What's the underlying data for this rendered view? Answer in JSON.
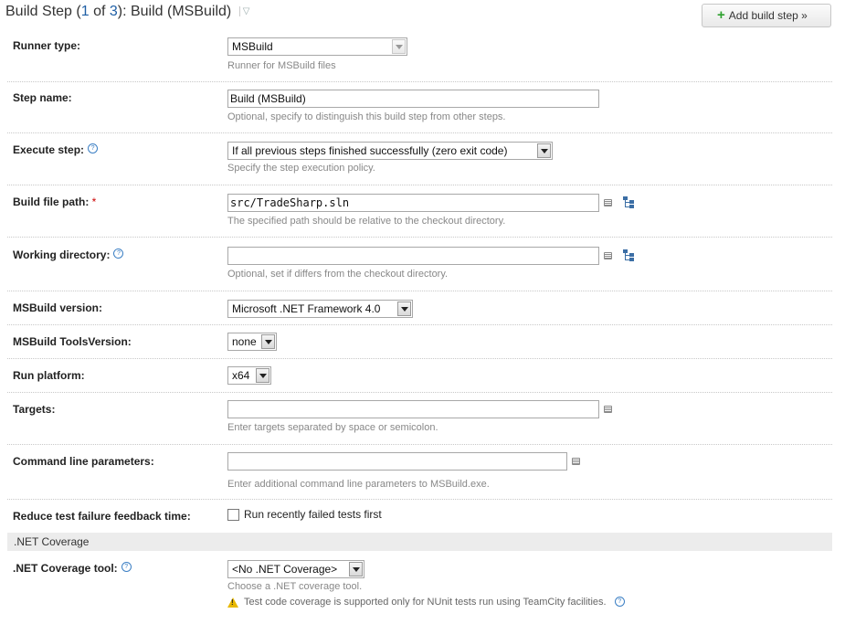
{
  "header": {
    "title_prefix": "Build Step (",
    "step_current": "1",
    "of": " of ",
    "step_total": "3",
    "title_suffix": "): Build (MSBuild)",
    "caret": "▽"
  },
  "add_button": {
    "plus": "+",
    "label": "Add build step »"
  },
  "runner": {
    "label": "Runner type:",
    "value": "MSBuild",
    "note": "Runner for MSBuild files"
  },
  "step_name": {
    "label": "Step name:",
    "value": "Build (MSBuild)",
    "note": "Optional, specify to distinguish this build step from other steps."
  },
  "execute": {
    "label": "Execute step:",
    "help": "?",
    "value": "If all previous steps finished successfully (zero exit code)",
    "note": "Specify the step execution policy."
  },
  "build_file": {
    "label": "Build file path:",
    "required": "*",
    "value": "src/TradeSharp.sln",
    "note": "The specified path should be relative to the checkout directory."
  },
  "working_dir": {
    "label": "Working directory:",
    "help": "?",
    "value": "",
    "note": "Optional, set if differs from the checkout directory."
  },
  "msbuild_version": {
    "label": "MSBuild version:",
    "value": "Microsoft .NET Framework 4.0"
  },
  "tools_version": {
    "label": "MSBuild ToolsVersion:",
    "value": "none"
  },
  "platform": {
    "label": "Run platform:",
    "value": "x64"
  },
  "targets": {
    "label": "Targets:",
    "value": "",
    "note": "Enter targets separated by space or semicolon."
  },
  "cmd_params": {
    "label": "Command line parameters:",
    "value": "",
    "note": "Enter additional command line parameters to MSBuild.exe."
  },
  "reduce": {
    "label": "Reduce test failure feedback time:",
    "checkbox_label": "Run recently failed tests first",
    "checked": false
  },
  "coverage_section": {
    "title": ".NET Coverage"
  },
  "coverage_tool": {
    "label": ".NET Coverage tool:",
    "help": "?",
    "value": "<No .NET Coverage>",
    "note": "Choose a .NET coverage tool.",
    "warning": "Test code coverage is supported only for NUnit tests run using TeamCity facilities."
  },
  "icons": {
    "help": "help-icon",
    "text_area": "expand-textarea-icon",
    "tree": "file-tree-icon",
    "add": "plus-icon",
    "warning": "warning-icon",
    "dropdown": "chevron-down-icon"
  },
  "colors": {
    "link": "#1f5fa5",
    "required": "#cc0000",
    "plus": "#2ea12e",
    "warning": "#e8b800"
  }
}
